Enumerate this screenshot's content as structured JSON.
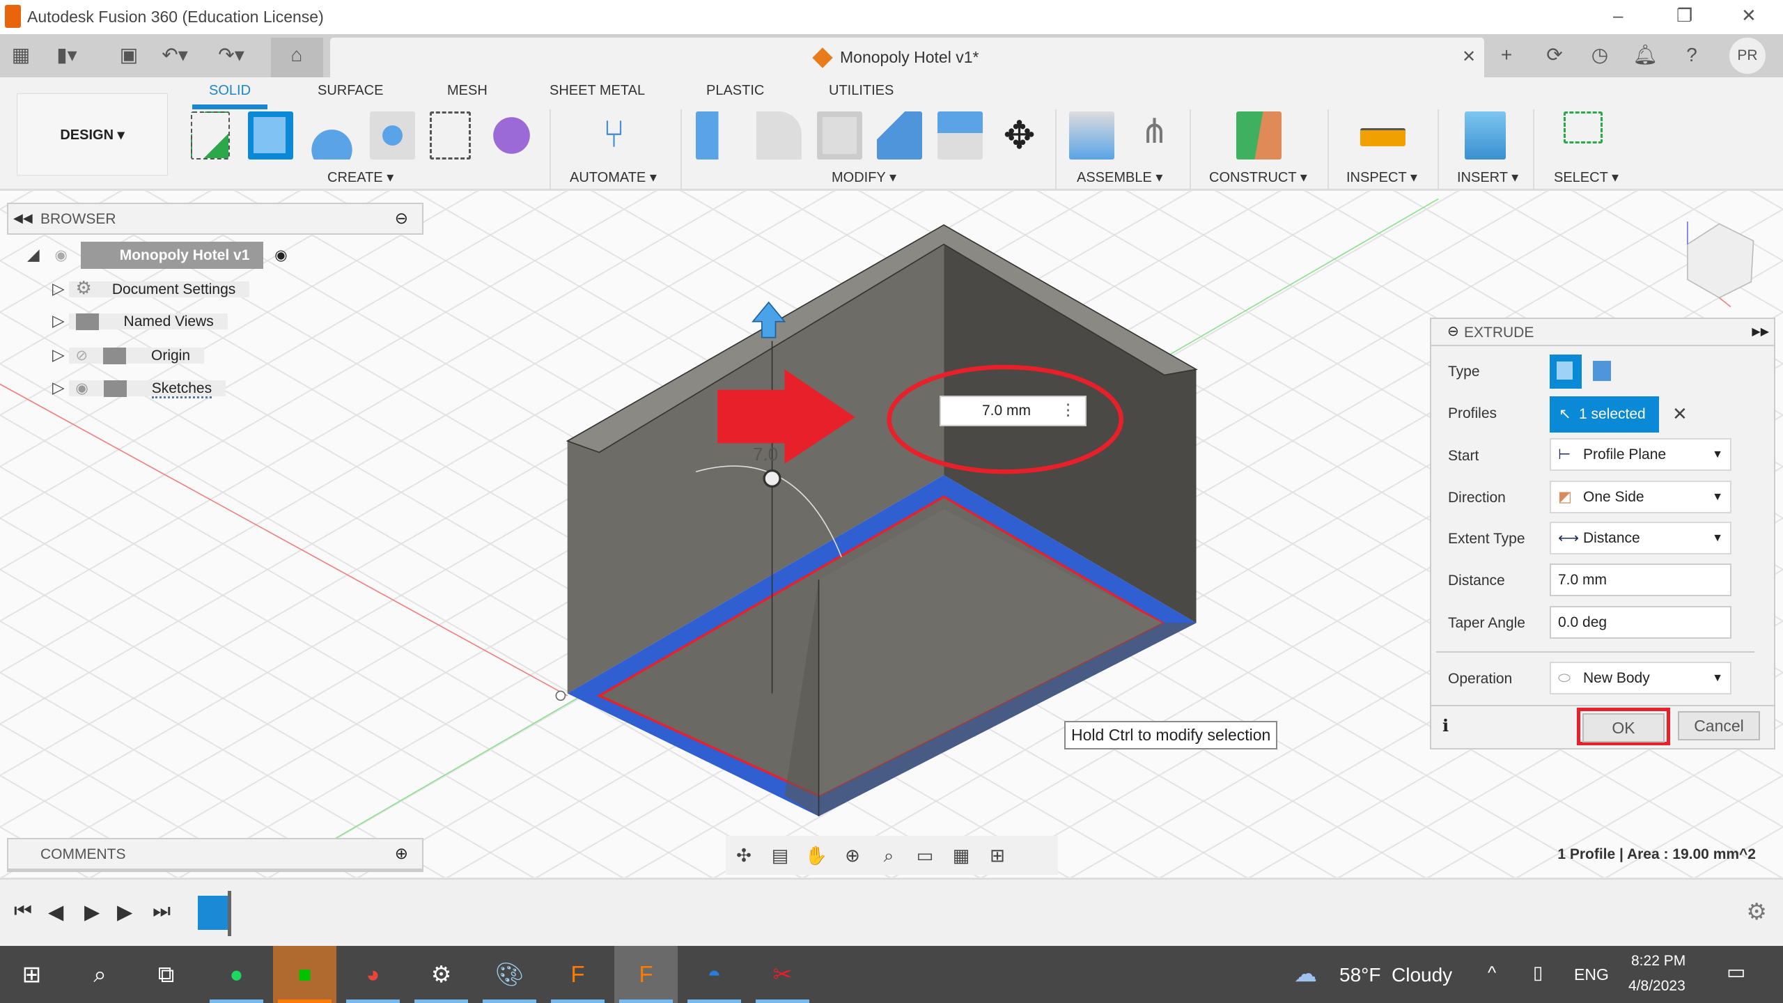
{
  "window": {
    "title": "Autodesk Fusion 360 (Education License)",
    "minimize": "–",
    "restore": "❐",
    "close": "✕"
  },
  "document": {
    "tab_title": "Monopoly Hotel v1*",
    "close": "✕",
    "user_initials": "PR"
  },
  "ribbon": {
    "workspace": "DESIGN ▾",
    "tabs": [
      "SOLID",
      "SURFACE",
      "MESH",
      "SHEET METAL",
      "PLASTIC",
      "UTILITIES"
    ],
    "groups": [
      "CREATE ▾",
      "AUTOMATE ▾",
      "MODIFY ▾",
      "ASSEMBLE ▾",
      "CONSTRUCT ▾",
      "INSPECT ▾",
      "INSERT ▾",
      "SELECT ▾"
    ]
  },
  "browser": {
    "title": "BROWSER",
    "root": "Monopoly Hotel v1",
    "items": [
      "Document Settings",
      "Named Views",
      "Origin",
      "Sketches"
    ]
  },
  "comments": {
    "title": "COMMENTS"
  },
  "viewport": {
    "distance_input": "7.0 mm",
    "dim_label": "7.0",
    "tooltip": "Hold Ctrl to modify selection",
    "status": "1 Profile | Area : 19.00 mm^2",
    "colors": {
      "selection": "#2f5fd0",
      "annotation": "#e8202a"
    }
  },
  "extrude": {
    "title": "EXTRUDE",
    "labels": {
      "type": "Type",
      "profiles": "Profiles",
      "start": "Start",
      "direction": "Direction",
      "extent": "Extent Type",
      "distance": "Distance",
      "taper": "Taper Angle",
      "operation": "Operation"
    },
    "profiles_value": "1 selected",
    "start_value": "Profile Plane",
    "direction_value": "One Side",
    "extent_value": "Distance",
    "distance_value": "7.0 mm",
    "taper_value": "0.0 deg",
    "operation_value": "New Body",
    "ok": "OK",
    "cancel": "Cancel"
  },
  "taskbar": {
    "weather": "58°F  Cloudy",
    "lang": "ENG",
    "time": "8:22 PM",
    "date": "4/8/2023"
  }
}
